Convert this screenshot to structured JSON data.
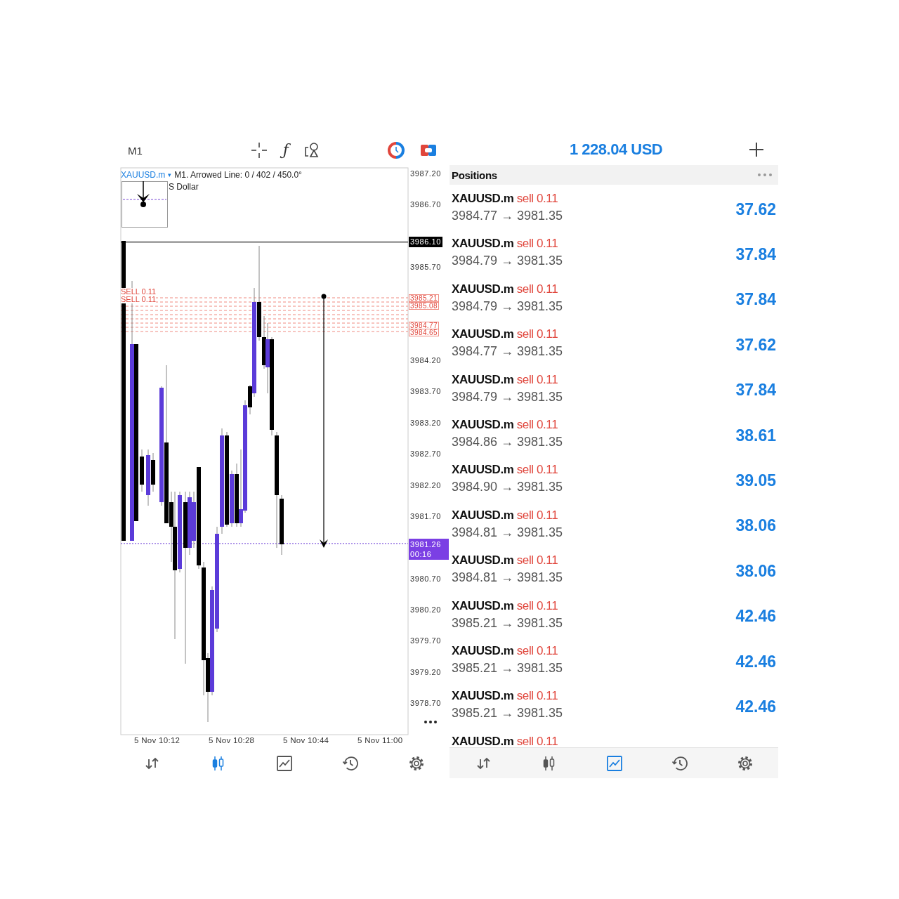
{
  "left_screen": {
    "timeframe": "M1",
    "function_glyph": "ƒ",
    "chart": {
      "symbol": "XAUUSD.m",
      "symbol_caret": "▾",
      "description": "M1. Arrowed Line: 0 / 402 / 450.0°",
      "legend_text": "S Dollar",
      "price_ticks": [
        "3987.20",
        "3986.70",
        "3985.70",
        "3984.20",
        "3983.70",
        "3983.20",
        "3982.70",
        "3982.20",
        "3981.70",
        "3980.70",
        "3980.20",
        "3979.70",
        "3979.20",
        "3978.70"
      ],
      "order_labels": [
        "SELL 0.11",
        "SELL 0.11"
      ],
      "order_price_tags": [
        "3985.21",
        "3985.08",
        "3984.77",
        "3984.65"
      ],
      "last_price_tag": "3986.10",
      "bid_tag": {
        "price": "3981.26",
        "countdown": "00:16"
      },
      "time_labels": [
        "5 Nov 10:12",
        "5 Nov 10:28",
        "5 Nov 10:44",
        "5 Nov 11:00"
      ]
    },
    "nav": [
      {
        "kind": "trade",
        "selected": false
      },
      {
        "kind": "chart",
        "selected": true
      },
      {
        "kind": "graph",
        "selected": false
      },
      {
        "kind": "history",
        "selected": false
      },
      {
        "kind": "settings",
        "selected": false
      }
    ]
  },
  "right_screen": {
    "balance": "1 228.04 USD",
    "section_title": "Positions",
    "positions": [
      {
        "symbol": "XAUUSD.m",
        "order": "sell 0.11",
        "prices": "3984.77 → 3981.35",
        "profit": "37.62"
      },
      {
        "symbol": "XAUUSD.m",
        "order": "sell 0.11",
        "prices": "3984.79 → 3981.35",
        "profit": "37.84"
      },
      {
        "symbol": "XAUUSD.m",
        "order": "sell 0.11",
        "prices": "3984.79 → 3981.35",
        "profit": "37.84"
      },
      {
        "symbol": "XAUUSD.m",
        "order": "sell 0.11",
        "prices": "3984.77 → 3981.35",
        "profit": "37.62"
      },
      {
        "symbol": "XAUUSD.m",
        "order": "sell 0.11",
        "prices": "3984.79 → 3981.35",
        "profit": "37.84"
      },
      {
        "symbol": "XAUUSD.m",
        "order": "sell 0.11",
        "prices": "3984.86 → 3981.35",
        "profit": "38.61"
      },
      {
        "symbol": "XAUUSD.m",
        "order": "sell 0.11",
        "prices": "3984.90 → 3981.35",
        "profit": "39.05"
      },
      {
        "symbol": "XAUUSD.m",
        "order": "sell 0.11",
        "prices": "3984.81 → 3981.35",
        "profit": "38.06"
      },
      {
        "symbol": "XAUUSD.m",
        "order": "sell 0.11",
        "prices": "3984.81 → 3981.35",
        "profit": "38.06"
      },
      {
        "symbol": "XAUUSD.m",
        "order": "sell 0.11",
        "prices": "3985.21 → 3981.35",
        "profit": "42.46"
      },
      {
        "symbol": "XAUUSD.m",
        "order": "sell 0.11",
        "prices": "3985.21 → 3981.35",
        "profit": "42.46"
      },
      {
        "symbol": "XAUUSD.m",
        "order": "sell 0.11",
        "prices": "3985.21 → 3981.35",
        "profit": "42.46"
      },
      {
        "symbol": "XAUUSD.m",
        "order": "sell 0.11"
      }
    ],
    "nav": [
      {
        "kind": "trade",
        "selected": false
      },
      {
        "kind": "chart",
        "selected": false
      },
      {
        "kind": "graph",
        "selected": true
      },
      {
        "kind": "history",
        "selected": false
      },
      {
        "kind": "settings",
        "selected": false
      }
    ]
  }
}
